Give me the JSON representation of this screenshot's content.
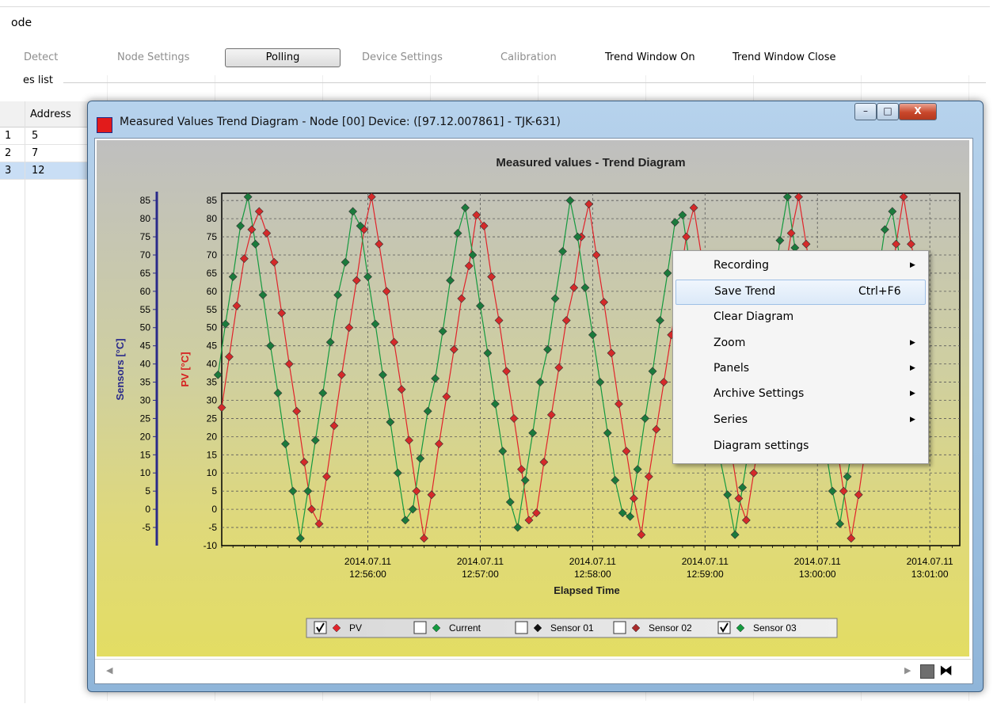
{
  "app": {
    "title_fragment": "ode",
    "toolbar": {
      "detect": "Detect",
      "node_settings": "Node Settings",
      "polling": "Polling",
      "device_settings": "Device Settings",
      "calibration": "Calibration",
      "trend_on": "Trend Window On",
      "trend_close": "Trend Window Close"
    },
    "devices_list_label": "es list",
    "grid": {
      "address_header": "Address",
      "rows": [
        {
          "idx": "1",
          "address": "5"
        },
        {
          "idx": "2",
          "address": "7"
        },
        {
          "idx": "3",
          "address": "12"
        }
      ]
    }
  },
  "dialog": {
    "title": "Measured Values Trend Diagram - Node [00] Device: ([97.12.007861] - TJK-631)",
    "buttons": {
      "minimize": "–",
      "maximize": "□",
      "close": "X"
    }
  },
  "context_menu": {
    "items": [
      {
        "label": "Recording",
        "submenu": true
      },
      {
        "label": "Save Trend",
        "shortcut": "Ctrl+F6",
        "highlighted": true
      },
      {
        "label": "Clear Diagram"
      },
      {
        "label": "Zoom",
        "submenu": true
      },
      {
        "label": "Panels",
        "submenu": true
      },
      {
        "label": "Archive Settings",
        "submenu": true
      },
      {
        "label": "Series",
        "submenu": true
      },
      {
        "label": "Diagram settings"
      }
    ]
  },
  "chart_data": {
    "type": "line",
    "title": "Measured values - Trend Diagram",
    "xlabel": "Elapsed Time",
    "ylabel_left_outer": "Sensors [°C]",
    "ylabel_left_inner": "PV [°C]",
    "ylim": [
      -10,
      87
    ],
    "yticks": [
      -10,
      -5,
      0,
      5,
      10,
      15,
      20,
      25,
      30,
      35,
      40,
      45,
      50,
      55,
      60,
      65,
      70,
      75,
      80,
      85
    ],
    "yticks_outer": [
      -5,
      0,
      5,
      10,
      15,
      20,
      25,
      30,
      35,
      40,
      45,
      50,
      55,
      60,
      65,
      70,
      75,
      80,
      85
    ],
    "xlim_seconds": [
      -39,
      158
    ],
    "xticks": [
      {
        "t": 0,
        "date": "2014.07.11",
        "time": "12:56:00"
      },
      {
        "t": 30,
        "date": "2014.07.11",
        "time": "12:57:00"
      },
      {
        "t": 60,
        "date": "2014.07.11",
        "time": "12:58:00"
      },
      {
        "t": 90,
        "date": "2014.07.11",
        "time": "12:59:00"
      },
      {
        "t": 120,
        "date": "2014.07.11",
        "time": "13:00:00"
      },
      {
        "t": 150,
        "date": "2014.07.11",
        "time": "13:01:00"
      }
    ],
    "grid": true,
    "series": [
      {
        "name": "PV",
        "color": "#e0232a",
        "marker": "#d42a2a",
        "points": [
          [
            -39,
            28
          ],
          [
            -37,
            42
          ],
          [
            -35,
            56
          ],
          [
            -33,
            69
          ],
          [
            -31,
            77
          ],
          [
            -29,
            82
          ],
          [
            -27,
            76
          ],
          [
            -25,
            68
          ],
          [
            -23,
            54
          ],
          [
            -21,
            40
          ],
          [
            -19,
            27
          ],
          [
            -17,
            13
          ],
          [
            -15,
            0
          ],
          [
            -13,
            -4
          ],
          [
            -11,
            9
          ],
          [
            -9,
            23
          ],
          [
            -7,
            37
          ],
          [
            -5,
            50
          ],
          [
            -3,
            63
          ],
          [
            -1,
            77
          ],
          [
            1,
            86
          ],
          [
            3,
            73
          ],
          [
            5,
            60
          ],
          [
            7,
            46
          ],
          [
            9,
            33
          ],
          [
            11,
            19
          ],
          [
            13,
            5
          ],
          [
            15,
            -8
          ],
          [
            17,
            4
          ],
          [
            19,
            18
          ],
          [
            21,
            31
          ],
          [
            23,
            44
          ],
          [
            25,
            58
          ],
          [
            27,
            67
          ],
          [
            29,
            81
          ],
          [
            31,
            78
          ],
          [
            33,
            64
          ],
          [
            35,
            52
          ],
          [
            37,
            38
          ],
          [
            39,
            25
          ],
          [
            41,
            11
          ],
          [
            43,
            -3
          ],
          [
            45,
            -1
          ],
          [
            47,
            13
          ],
          [
            49,
            26
          ],
          [
            51,
            39
          ],
          [
            53,
            52
          ],
          [
            55,
            61
          ],
          [
            57,
            75
          ],
          [
            59,
            84
          ],
          [
            61,
            70
          ],
          [
            63,
            57
          ],
          [
            65,
            43
          ],
          [
            67,
            29
          ],
          [
            69,
            16
          ],
          [
            71,
            3
          ],
          [
            73,
            -7
          ],
          [
            75,
            9
          ],
          [
            77,
            22
          ],
          [
            79,
            35
          ],
          [
            81,
            48
          ],
          [
            83,
            61
          ],
          [
            85,
            75
          ],
          [
            87,
            83
          ],
          [
            89,
            70
          ],
          [
            91,
            56
          ],
          [
            93,
            43
          ],
          [
            95,
            30
          ],
          [
            97,
            16
          ],
          [
            99,
            3
          ],
          [
            101,
            -3
          ],
          [
            103,
            10
          ],
          [
            105,
            23
          ],
          [
            107,
            37
          ],
          [
            109,
            50
          ],
          [
            111,
            63
          ],
          [
            113,
            76
          ],
          [
            115,
            86
          ],
          [
            117,
            73
          ],
          [
            119,
            60
          ],
          [
            121,
            46
          ],
          [
            123,
            33
          ],
          [
            125,
            19
          ],
          [
            127,
            5
          ],
          [
            129,
            -8
          ],
          [
            131,
            4
          ],
          [
            133,
            18
          ],
          [
            135,
            31
          ],
          [
            137,
            44
          ],
          [
            139,
            58
          ],
          [
            141,
            73
          ],
          [
            143,
            86
          ],
          [
            145,
            73
          ],
          [
            147,
            64
          ]
        ]
      },
      {
        "name": "Current",
        "visible": false
      },
      {
        "name": "Sensor 01",
        "visible": false
      },
      {
        "name": "Sensor 02",
        "visible": false
      },
      {
        "name": "Sensor 03",
        "color": "#14993f",
        "marker": "#1b7a3c",
        "points": [
          [
            -40,
            37
          ],
          [
            -38,
            51
          ],
          [
            -36,
            64
          ],
          [
            -34,
            78
          ],
          [
            -32,
            86
          ],
          [
            -30,
            73
          ],
          [
            -28,
            59
          ],
          [
            -26,
            45
          ],
          [
            -24,
            32
          ],
          [
            -22,
            18
          ],
          [
            -20,
            5
          ],
          [
            -18,
            -8
          ],
          [
            -16,
            5
          ],
          [
            -14,
            19
          ],
          [
            -12,
            32
          ],
          [
            -10,
            46
          ],
          [
            -8,
            59
          ],
          [
            -6,
            68
          ],
          [
            -4,
            82
          ],
          [
            -2,
            78
          ],
          [
            0,
            64
          ],
          [
            2,
            51
          ],
          [
            4,
            37
          ],
          [
            6,
            24
          ],
          [
            8,
            10
          ],
          [
            10,
            -3
          ],
          [
            12,
            0
          ],
          [
            14,
            14
          ],
          [
            16,
            27
          ],
          [
            18,
            36
          ],
          [
            20,
            49
          ],
          [
            22,
            63
          ],
          [
            24,
            76
          ],
          [
            26,
            83
          ],
          [
            28,
            70
          ],
          [
            30,
            56
          ],
          [
            32,
            43
          ],
          [
            34,
            29
          ],
          [
            36,
            16
          ],
          [
            38,
            2
          ],
          [
            40,
            -5
          ],
          [
            42,
            8
          ],
          [
            44,
            21
          ],
          [
            46,
            35
          ],
          [
            48,
            44
          ],
          [
            50,
            58
          ],
          [
            52,
            71
          ],
          [
            54,
            85
          ],
          [
            56,
            75
          ],
          [
            58,
            61
          ],
          [
            60,
            48
          ],
          [
            62,
            35
          ],
          [
            64,
            21
          ],
          [
            66,
            8
          ],
          [
            68,
            -1
          ],
          [
            70,
            -2
          ],
          [
            72,
            11
          ],
          [
            74,
            25
          ],
          [
            76,
            38
          ],
          [
            78,
            52
          ],
          [
            80,
            65
          ],
          [
            82,
            79
          ],
          [
            84,
            81
          ],
          [
            86,
            67
          ],
          [
            88,
            54
          ],
          [
            90,
            41
          ],
          [
            92,
            27
          ],
          [
            94,
            14
          ],
          [
            96,
            4
          ],
          [
            98,
            -7
          ],
          [
            100,
            6
          ],
          [
            102,
            19
          ],
          [
            104,
            33
          ],
          [
            106,
            46
          ],
          [
            108,
            59
          ],
          [
            110,
            74
          ],
          [
            112,
            86
          ],
          [
            114,
            72
          ],
          [
            116,
            59
          ],
          [
            118,
            45
          ],
          [
            120,
            32
          ],
          [
            122,
            18
          ],
          [
            124,
            5
          ],
          [
            126,
            -4
          ],
          [
            128,
            9
          ],
          [
            130,
            22
          ],
          [
            132,
            36
          ],
          [
            134,
            49
          ],
          [
            136,
            63
          ],
          [
            138,
            77
          ],
          [
            140,
            82
          ],
          [
            142,
            69
          ],
          [
            144,
            55
          ]
        ]
      }
    ],
    "legend": [
      {
        "label": "PV",
        "checked": true,
        "color": "#e0232a"
      },
      {
        "label": "Current",
        "checked": false,
        "color": "#14993f"
      },
      {
        "label": "Sensor 01",
        "checked": false,
        "color": "#111111"
      },
      {
        "label": "Sensor 02",
        "checked": false,
        "color": "#a82a2a"
      },
      {
        "label": "Sensor 03",
        "checked": true,
        "color": "#14993f"
      }
    ],
    "legend_placement": "bottom-center"
  }
}
